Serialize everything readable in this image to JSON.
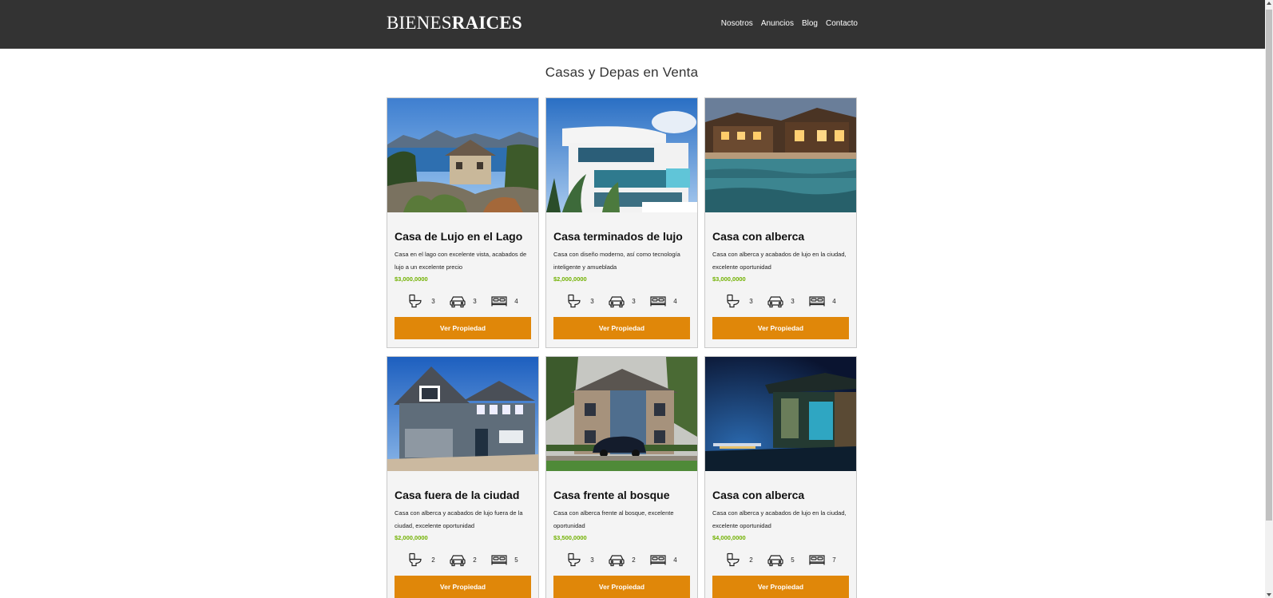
{
  "header": {
    "logo_thin": "BIENES",
    "logo_bold": "RAICES",
    "nav": [
      "Nosotros",
      "Anuncios",
      "Blog",
      "Contacto"
    ]
  },
  "main": {
    "title": "Casas y Depas en Venta",
    "button_label": "Ver Propiedad",
    "cards": [
      {
        "title": "Casa de Lujo en el Lago",
        "desc": "Casa en el lago con excelente vista, acabados de lujo a un excelente precio",
        "price": "$3,000,0000",
        "wc": "3",
        "parking": "3",
        "bedrooms": "4",
        "photo": "lake-house"
      },
      {
        "title": "Casa terminados de lujo",
        "desc": "Casa con diseño moderno, así como tecnología inteligente y amueblada",
        "price": "$2,000,0000",
        "wc": "3",
        "parking": "3",
        "bedrooms": "4",
        "photo": "modern-house"
      },
      {
        "title": "Casa con alberca",
        "desc": "Casa con alberca y acabados de lujo en la ciudad, excelente oportunidad",
        "price": "$3,000,0000",
        "wc": "3",
        "parking": "3",
        "bedrooms": "4",
        "photo": "pool-lodge"
      },
      {
        "title": "Casa fuera de la ciudad",
        "desc": "Casa con alberca y acabados de lujo fuera de la ciudad, excelente oportunidad",
        "price": "$2,000,0000",
        "wc": "2",
        "parking": "2",
        "bedrooms": "5",
        "photo": "suburban-house"
      },
      {
        "title": "Casa frente al bosque",
        "desc": "Casa con alberca frente al bosque, excelente oportunidad",
        "price": "$3,500,0000",
        "wc": "3",
        "parking": "2",
        "bedrooms": "4",
        "photo": "brick-house"
      },
      {
        "title": "Casa con alberca",
        "desc": "Casa con alberca y acabados de lujo en la ciudad, excelente oportunidad",
        "price": "$4,000,0000",
        "wc": "2",
        "parking": "5",
        "bedrooms": "7",
        "photo": "night-house"
      }
    ]
  },
  "colors": {
    "header_bg": "#333333",
    "button": "#e08709",
    "price": "#71b100",
    "card_bg": "#f4f4f4"
  },
  "icons": [
    "toilet-icon",
    "car-icon",
    "bed-icon"
  ]
}
